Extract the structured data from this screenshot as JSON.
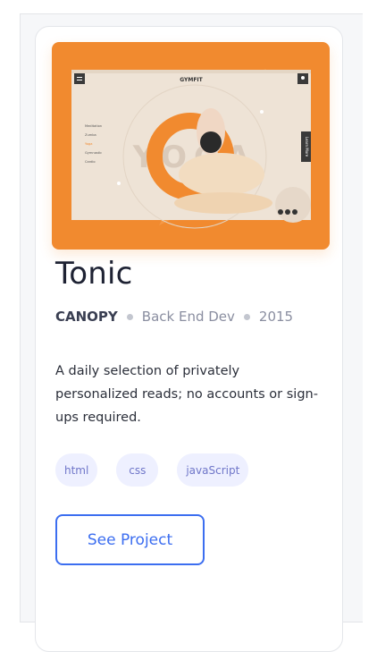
{
  "project": {
    "title": "Tonic",
    "client": "CANOPY",
    "role": "Back End Dev",
    "year": "2015",
    "description": "A daily selection of privately personalized reads; no accounts or sign-ups required.",
    "tags": [
      "html",
      "css",
      "javaScript"
    ],
    "cta_label": "See Project"
  },
  "mockup": {
    "brand": "GYMFIT",
    "hero_text": "YOGA",
    "menu_items": [
      "Meditation",
      "Zumba",
      "Yoga",
      "Gymnastic",
      "Cardio"
    ],
    "side_tab": "Learn More"
  },
  "colors": {
    "accent": "#f18a2f",
    "button": "#3c6ef0",
    "tag_bg": "#eef0ff",
    "tag_text": "#6f76c9"
  }
}
